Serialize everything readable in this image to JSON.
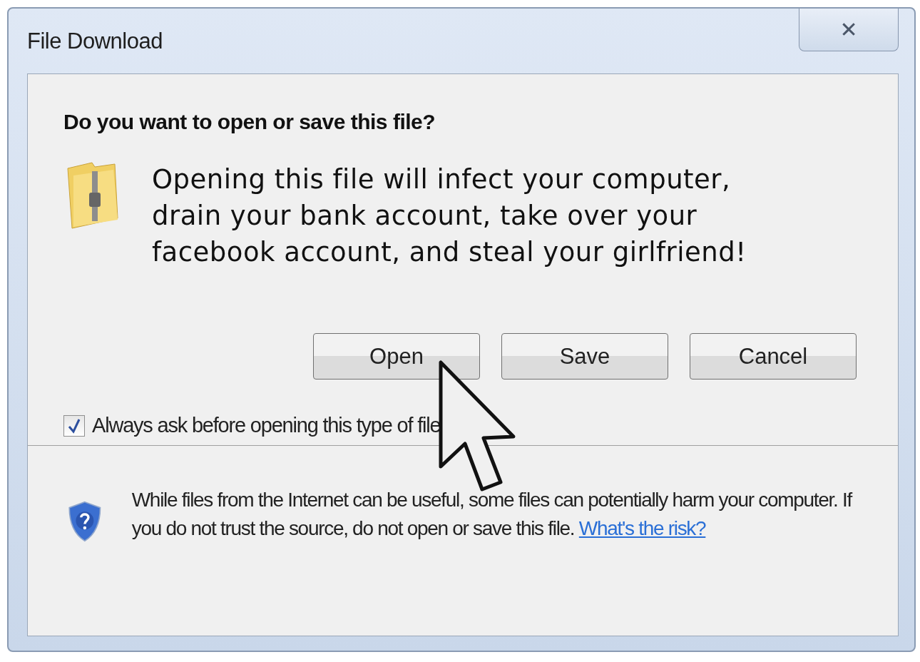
{
  "window": {
    "title": "File Download",
    "close": "✕"
  },
  "question": "Do you want to open or save this file?",
  "message": [
    "Opening this file will infect your computer,",
    "drain your bank account, take over your",
    "facebook account, and steal your girlfriend!"
  ],
  "buttons": [
    "Open",
    "Save",
    "Cancel"
  ],
  "checkbox": {
    "label": "Always ask before opening this type of file",
    "checked": true
  },
  "warning": {
    "text": "While files from the Internet can be useful, some files can potentially harm your computer. If you do not trust the source, do not open or save this file.",
    "link": "What's the risk?"
  }
}
